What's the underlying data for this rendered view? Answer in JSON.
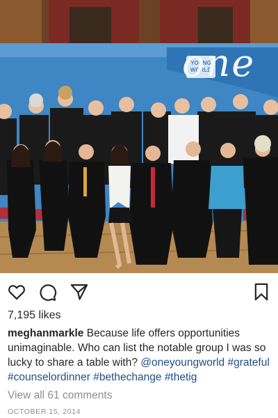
{
  "post": {
    "banner_badge": "YOUNG WORLD",
    "banner_wordmark": "one",
    "likes": "7,195 likes",
    "caption": {
      "username": "meghanmarkle",
      "text": " Because life offers opportunities unimaginable. Who can list the notable group I was so lucky to share a table with? ",
      "mention": "@oneyoungworld",
      "hashtags": [
        "#grateful",
        "#counselordinner",
        "#bethechange",
        "#thetig"
      ]
    },
    "comments_link": "View all 61 comments",
    "date": "OCTOBER 15, 2014"
  },
  "icons": {
    "like": "heart-outline-icon",
    "comment": "comment-bubble-icon",
    "share": "paper-plane-icon",
    "save": "bookmark-outline-icon"
  }
}
